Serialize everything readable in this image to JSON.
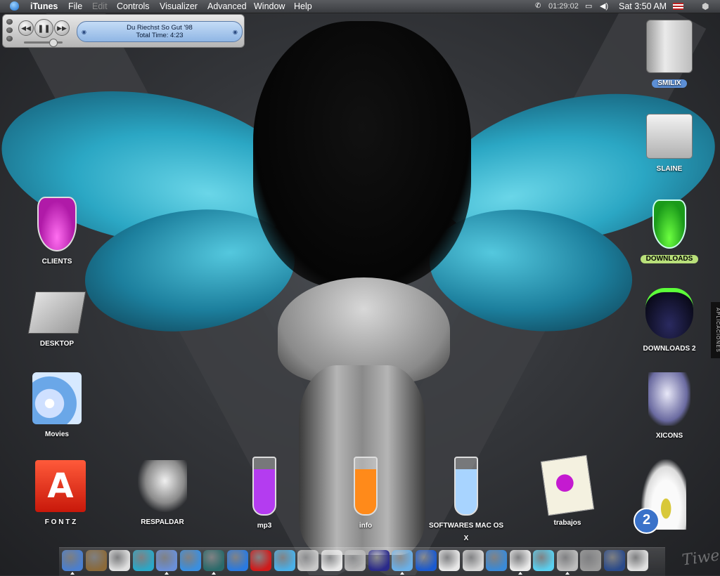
{
  "menubar": {
    "app_name": "iTunes",
    "menus": [
      "File",
      "Edit",
      "Controls",
      "Visualizer",
      "Advanced",
      "Window",
      "Help"
    ],
    "timer": "01:29:02",
    "clock": "Sat 3:50 AM"
  },
  "itunes": {
    "track": "Du Riechst So Gut '98",
    "total_time": "Total Time: 4:23"
  },
  "desktop_icons": {
    "smilix": "SMILIX",
    "slaine": "SLAINE",
    "clients": "CLIENTS",
    "downloads": "DOWNLOADS",
    "desktop": "DESKTOP",
    "downloads2": "DOWNLOADS 2",
    "movies": "Movies",
    "xicons": "XICONS",
    "fontz": "F O N T Z",
    "respaldar": "RESPALDAR",
    "mp3": "mp3",
    "info": "info",
    "softwares": "SOFTWARES MAC OS X",
    "trabajos": "trabajos"
  },
  "trash_badge": "2",
  "side_tab": "APLICACIONES",
  "wallpaper_signature": "Tiwe",
  "dock": {
    "apps": [
      "finder",
      "iphoto",
      "graphicconverter",
      "sidekick",
      "script-editor",
      "safari",
      "netscape",
      "internet-explorer",
      "acrobat",
      "msn-messenger",
      "terminal",
      "stuffit",
      "dvd-player",
      "eye-app",
      "preview",
      "quicktime",
      "iterm",
      "mail",
      "scrapbook",
      "x11",
      "sciences",
      "home",
      "ichat",
      "user-folder",
      "trash"
    ]
  },
  "colors": {
    "wing": "#2bb7cf",
    "menubar": "#4a4c50",
    "lcd": "#a9c9ee"
  }
}
